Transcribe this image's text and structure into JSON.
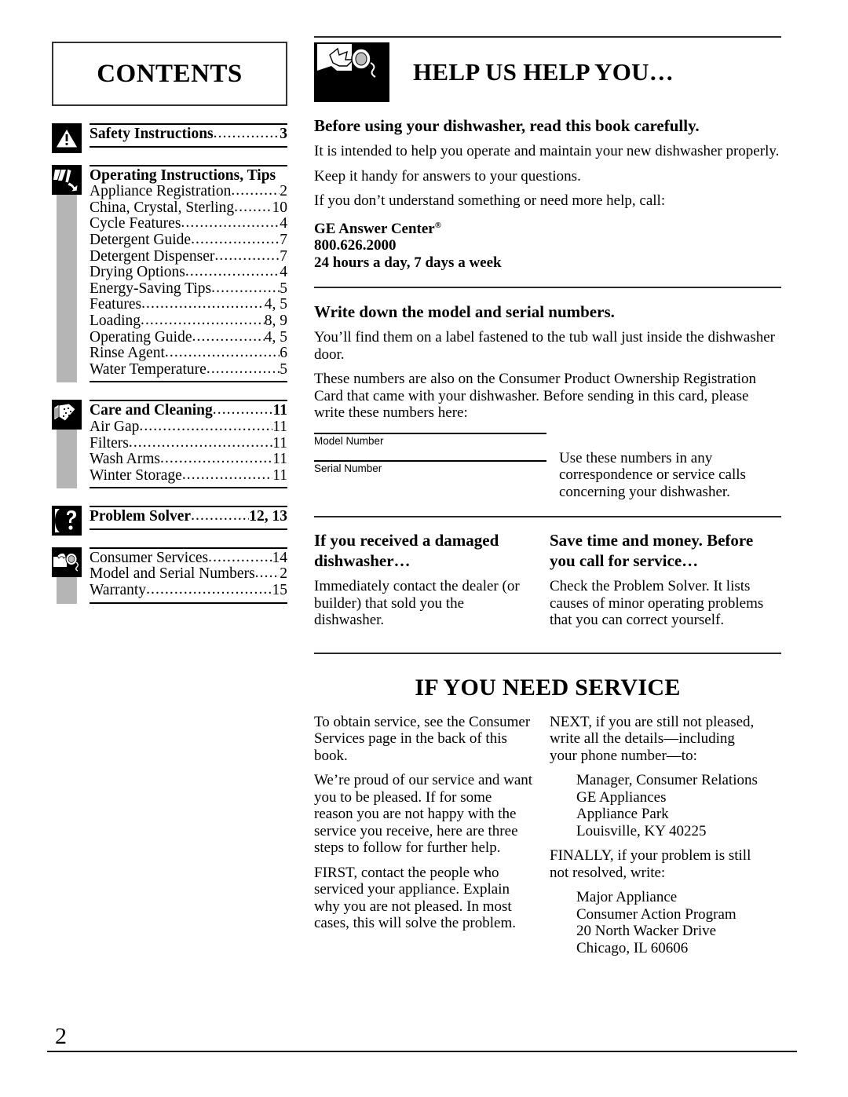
{
  "contents": {
    "title": "CONTENTS",
    "groups": [
      {
        "icon": "warning-triangle-icon",
        "has_gray_bar": false,
        "items": [
          {
            "label": "Safety Instructions",
            "page": "3",
            "bold": true
          }
        ]
      },
      {
        "icon": "operating-hand-icon",
        "has_gray_bar": true,
        "items": [
          {
            "label": "Operating Instructions, Tips",
            "page": "",
            "bold": true
          },
          {
            "label": "Appliance Registration",
            "page": "2",
            "bold": false
          },
          {
            "label": "China, Crystal, Sterling",
            "page": "10",
            "bold": false
          },
          {
            "label": "Cycle Features",
            "page": "4",
            "bold": false
          },
          {
            "label": "Detergent Guide",
            "page": "7",
            "bold": false
          },
          {
            "label": "Detergent Dispenser",
            "page": "7",
            "bold": false
          },
          {
            "label": "Drying Options",
            "page": "4",
            "bold": false
          },
          {
            "label": "Energy-Saving Tips",
            "page": "5",
            "bold": false
          },
          {
            "label": "Features",
            "page": "4, 5",
            "bold": false
          },
          {
            "label": "Loading",
            "page": "8, 9",
            "bold": false
          },
          {
            "label": "Operating Guide",
            "page": "4, 5",
            "bold": false
          },
          {
            "label": "Rinse Agent",
            "page": "6",
            "bold": false
          },
          {
            "label": "Water Temperature",
            "page": "5",
            "bold": false
          }
        ]
      },
      {
        "icon": "care-cleaning-icon",
        "has_gray_bar": true,
        "items": [
          {
            "label": "Care and Cleaning",
            "page": "11",
            "bold": true
          },
          {
            "label": "Air Gap",
            "page": "11",
            "bold": false
          },
          {
            "label": "Filters",
            "page": "11",
            "bold": false
          },
          {
            "label": "Wash Arms",
            "page": "11",
            "bold": false
          },
          {
            "label": "Winter Storage",
            "page": "11",
            "bold": false
          }
        ]
      },
      {
        "icon": "problem-solver-icon",
        "has_gray_bar": false,
        "items": [
          {
            "label": "Problem Solver",
            "page": "12, 13",
            "bold": true
          }
        ]
      },
      {
        "icon": "telephone-icon",
        "has_gray_bar": true,
        "items": [
          {
            "label": "Consumer Services",
            "page": "14",
            "bold": false
          },
          {
            "label": "Model and Serial Numbers",
            "page": "2",
            "bold": false
          },
          {
            "label": "Warranty",
            "page": "15",
            "bold": false
          }
        ]
      }
    ]
  },
  "help": {
    "icon": "person-telephone-icon",
    "title": "HELP US HELP YOU…",
    "heading": "Before using your dishwasher, read this book carefully.",
    "para1": "It is intended to help you operate and maintain your new dishwasher properly.",
    "para2": "Keep it handy for answers to your questions.",
    "para3": "If you don’t understand something or need more help, call:",
    "answer_center_name": "GE Answer Center",
    "answer_center_mark": "®",
    "answer_center_phone": "800.626.2000",
    "answer_center_hours": "24 hours a day, 7 days a week"
  },
  "numbers": {
    "heading": "Write down the model and serial numbers.",
    "para1": "You’ll find them on a label fastened to the tub wall just inside the dishwasher door.",
    "para2": "These numbers are also on the Consumer Product Ownership Registration Card that came with your dishwasher. Before sending in this card, please write these numbers here:",
    "model_label": "Model Number",
    "serial_label": "Serial Number",
    "note": "Use these numbers in any correspondence or service calls concerning your dishwasher."
  },
  "damaged": {
    "heading": "If you received a damaged dishwasher…",
    "body": "Immediately contact the dealer (or builder) that sold you the dishwasher."
  },
  "savetime": {
    "heading": "Save time and money. Before you call for service…",
    "body": "Check the Problem Solver. It lists causes of minor operating problems that you can correct yourself."
  },
  "service": {
    "title": "IF YOU NEED SERVICE",
    "left_paras": [
      "To obtain service, see the Consumer Services page in the back of this book.",
      "We’re proud of our service and want you to be pleased. If for some reason you are not happy with the service you receive, here are three steps to follow for further help.",
      "FIRST, contact the people who serviced your appliance. Explain why you are not pleased. In most cases, this will solve the problem."
    ],
    "next_intro": "NEXT, if you are still not pleased, write all the details—including your phone number—to:",
    "next_address": "Manager, Consumer Relations\nGE Appliances\nAppliance Park\nLouisville, KY 40225",
    "finally_intro": "FINALLY, if your problem is still not resolved, write:",
    "finally_address": "Major Appliance\nConsumer Action Program\n20 North Wacker Drive\nChicago, IL 60606"
  },
  "footer": {
    "page_number": "2"
  },
  "colors": {
    "ink": "#000000",
    "gray_bar": "#b5b5b5",
    "rule": "#2a2a2a"
  }
}
